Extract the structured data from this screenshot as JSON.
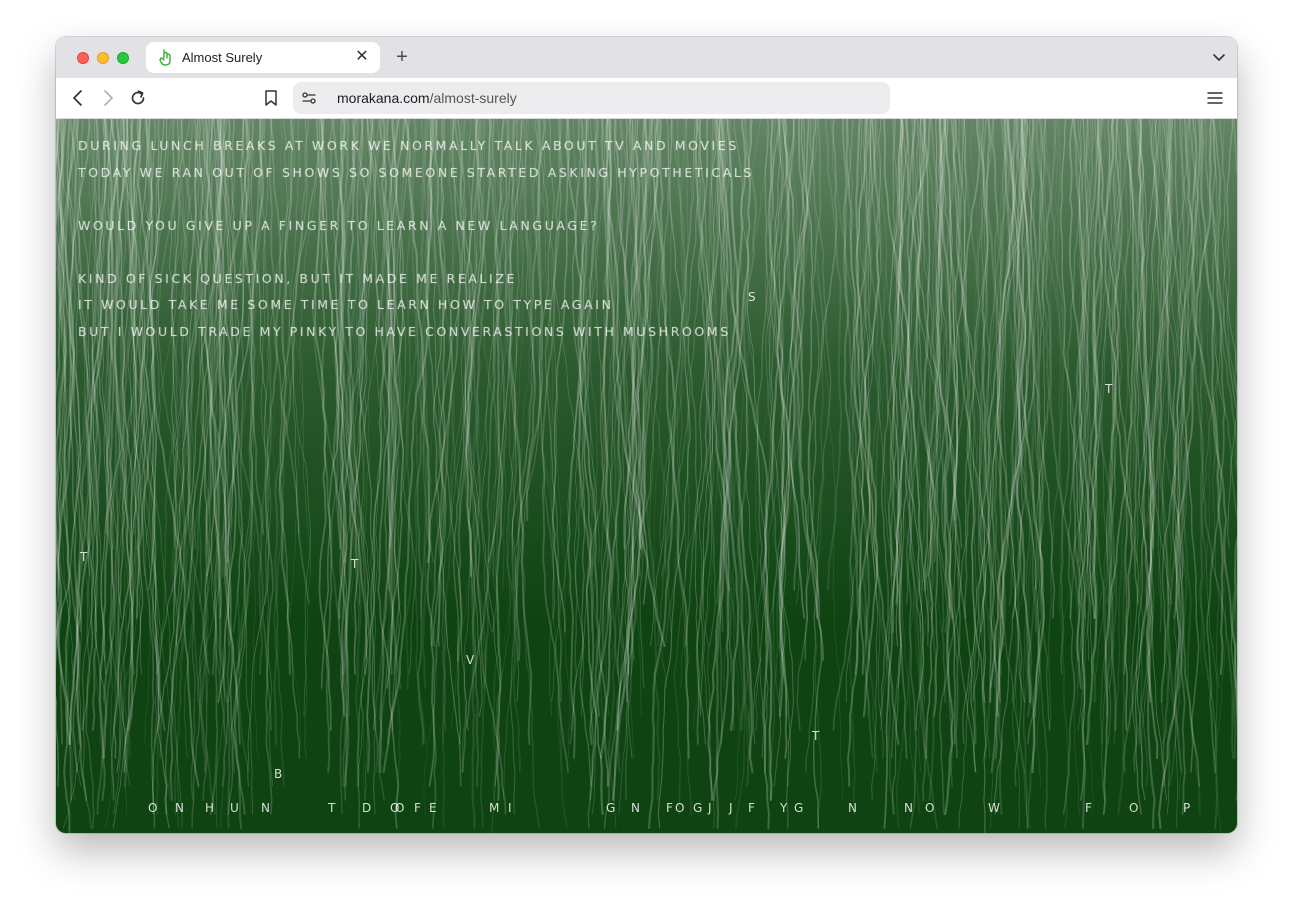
{
  "browser": {
    "tab_title": "Almost Surely",
    "new_tab_label": "+",
    "close_label": "✕",
    "url_host": "morakana.com",
    "url_path": "/almost-surely"
  },
  "poem": {
    "lines": [
      "DURING LUNCH BREAKS AT WORK WE NORMALLY TALK ABOUT TV AND MOVIES",
      "TODAY WE RAN OUT OF SHOWS SO SOMEONE STARTED ASKING HYPOTHETICALS",
      "",
      "WOULD YOU GIVE UP A FINGER TO LEARN A NEW LANGUAGE?",
      "",
      "KIND OF SICK QUESTION, BUT IT MADE ME REALIZE",
      "IT WOULD TAKE ME SOME TIME TO LEARN HOW TO TYPE AGAIN",
      "BUT I WOULD TRADE MY PINKY TO HAVE CONVERASTIONS WITH MUSHROOMS"
    ]
  },
  "falling_letters": [
    "S",
    "T",
    "T",
    "T",
    "V",
    "T",
    "B"
  ],
  "ground_letters": [
    "O",
    "N",
    "H",
    "U",
    "N",
    "T",
    "D",
    "O",
    "O",
    "F",
    "E",
    "M",
    "I",
    "G",
    "N",
    "F",
    "O",
    "G",
    "J",
    "J",
    "F",
    "Y",
    "G",
    "N",
    "N",
    "O",
    "W",
    "F",
    "O",
    "P"
  ],
  "colors": {
    "background": "#0f4412",
    "strand": "#ffffff",
    "tabbar": "#e2e2e6"
  }
}
